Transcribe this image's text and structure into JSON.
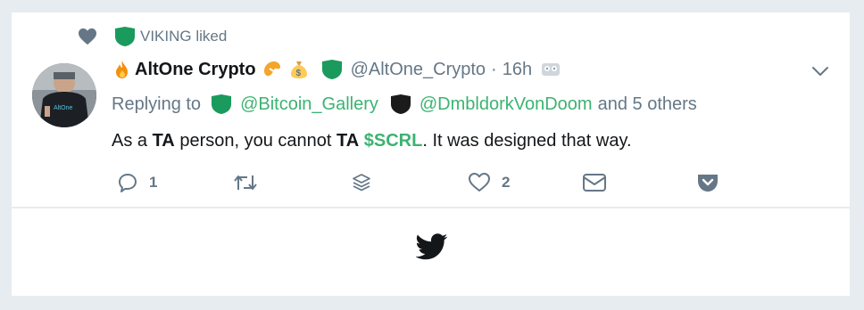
{
  "social_context": {
    "text": "VIKING liked",
    "icon": "heart-icon"
  },
  "tweet": {
    "display_name": "AltOne Crypto",
    "handle": "@AltOne_Crypto",
    "separator": "·",
    "time": "16h",
    "replying_to_label": "Replying to",
    "mentions": [
      "@Bitcoin_Gallery",
      "@DmbldorkVonDoom"
    ],
    "others": "and 5 others",
    "text": {
      "part1": "As a ",
      "bold1": "TA",
      "part2": " person, you cannot ",
      "bold2": "TA",
      "space": " ",
      "cashtag": "$SCRL",
      "part3": ". It was designed that way."
    },
    "actions": {
      "reply_count": "1",
      "like_count": "2"
    }
  },
  "colors": {
    "accent_green": "#3cb371",
    "muted": "#657786",
    "background": "#e6ecf0"
  }
}
